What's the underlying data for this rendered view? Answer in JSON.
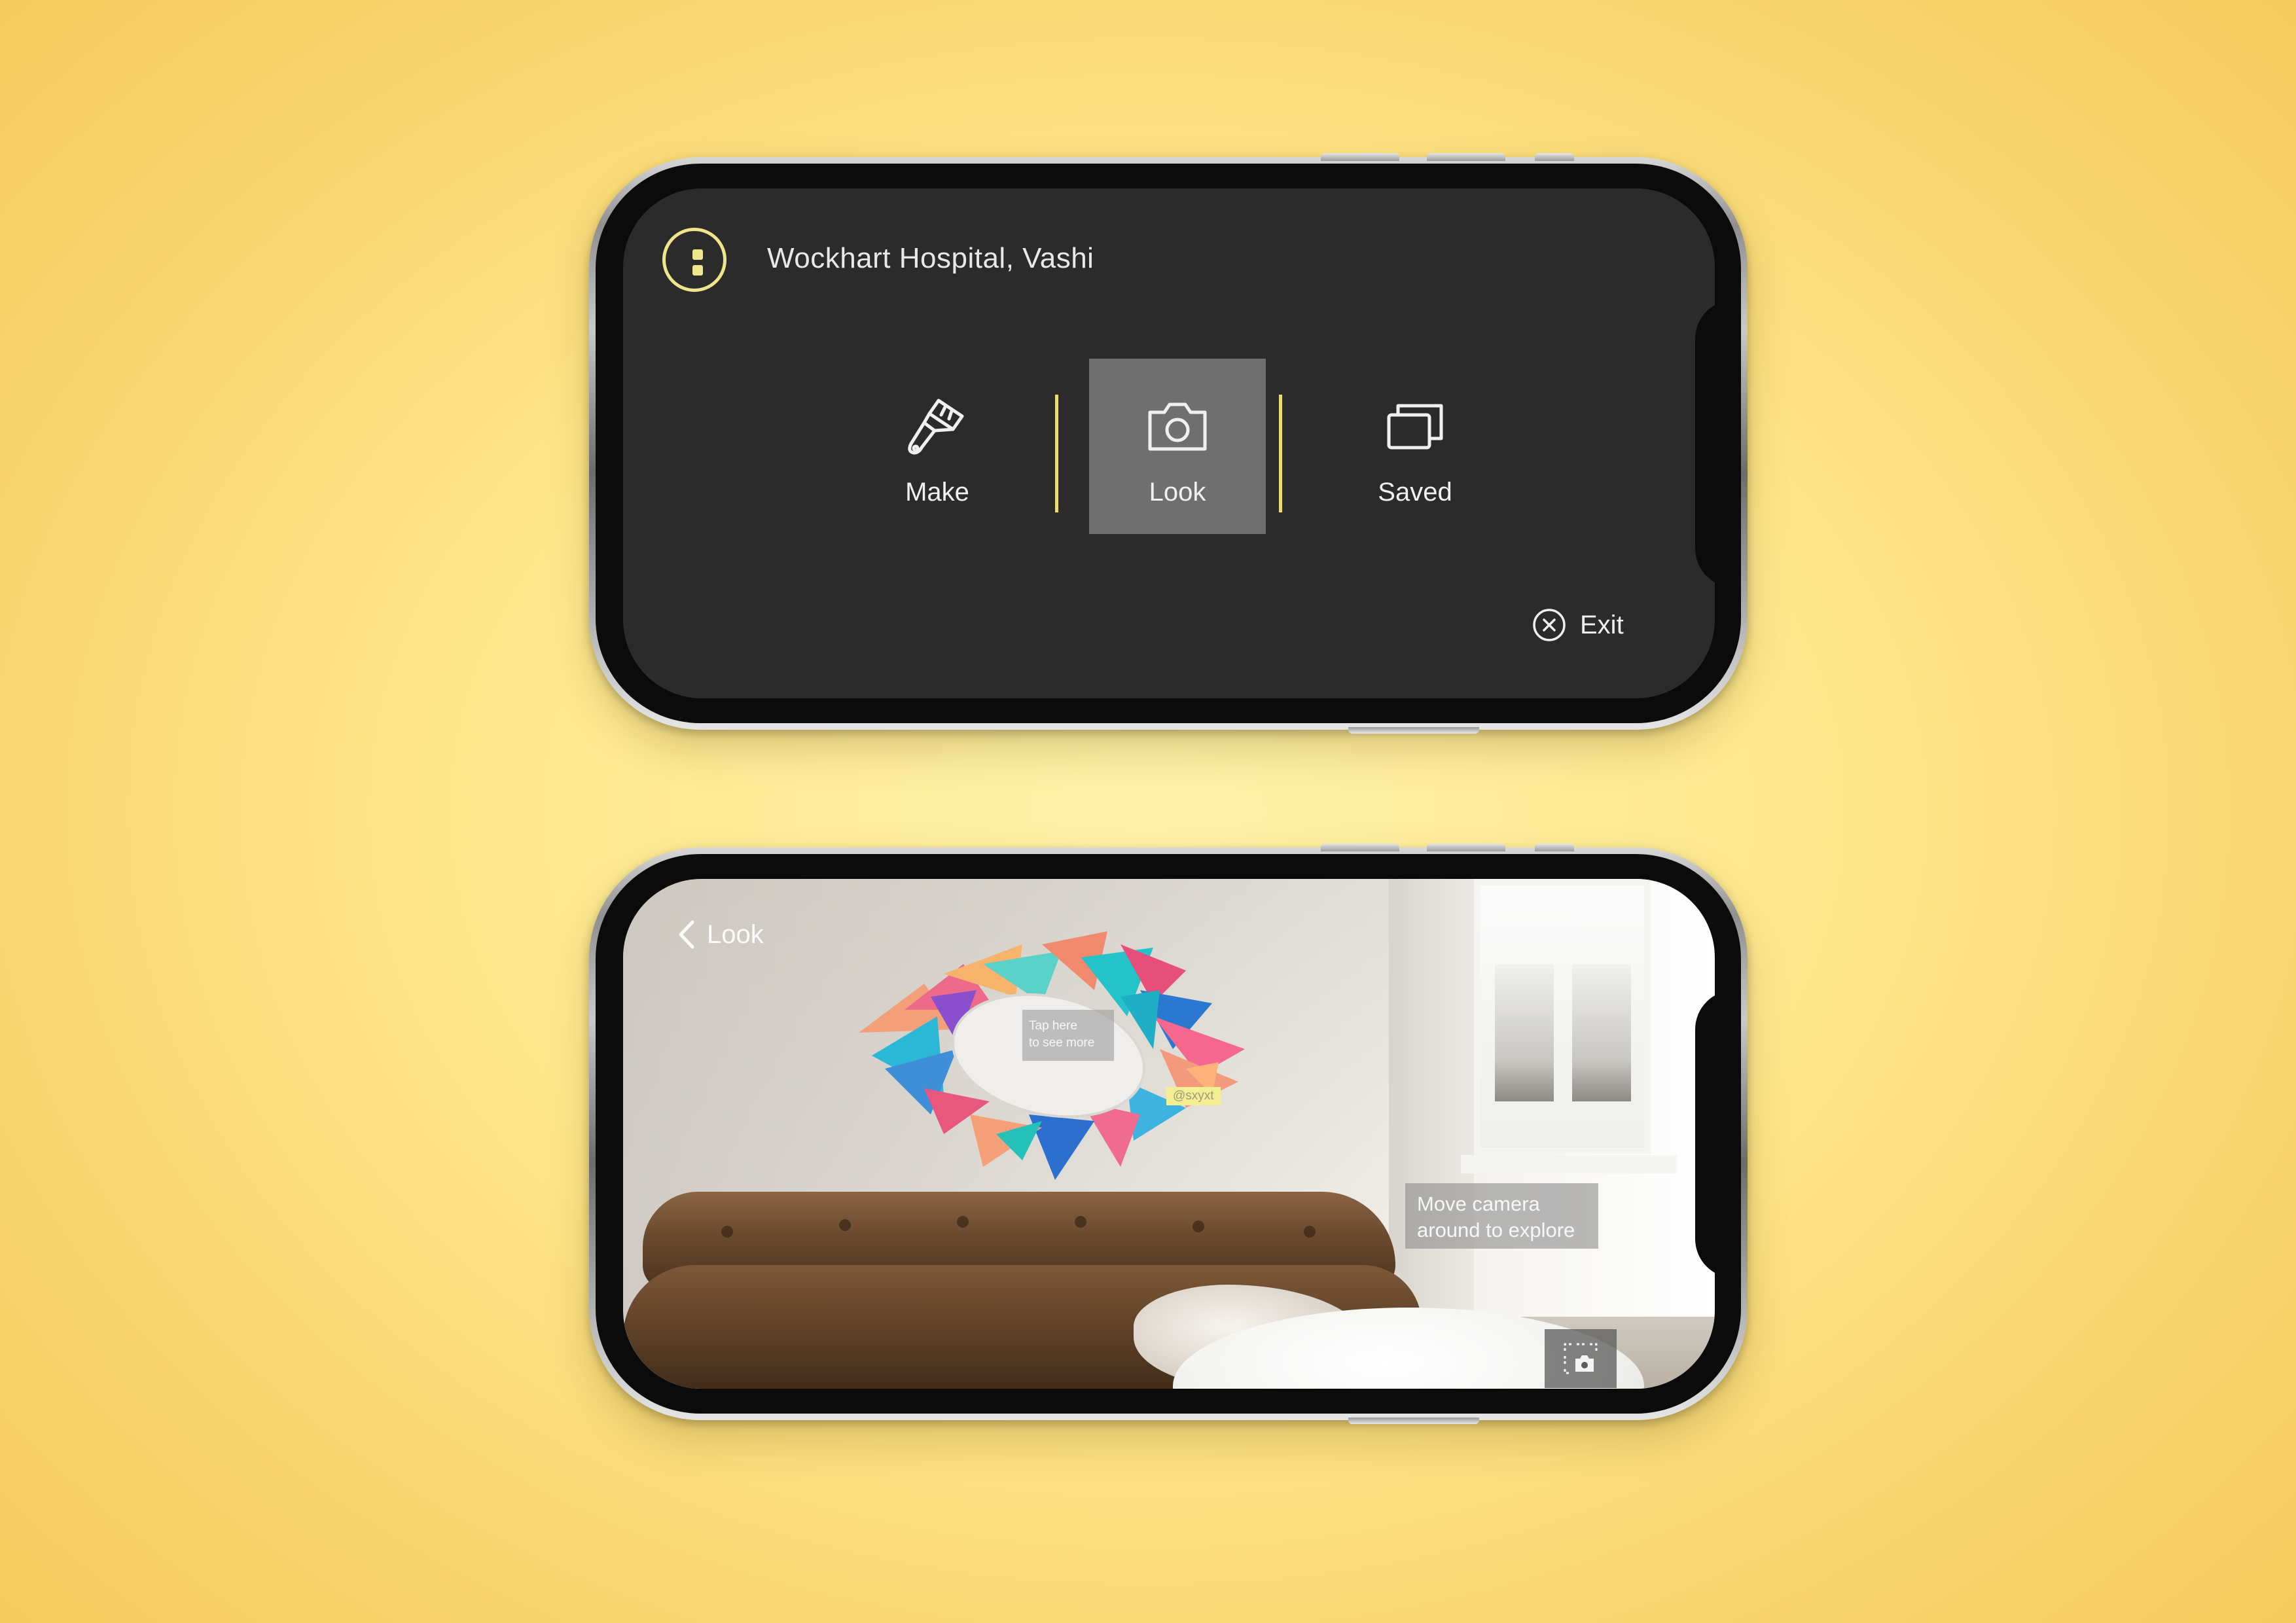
{
  "menu_screen": {
    "location_title": "Wockhart Hospital, Vashi",
    "menu_icon": "more-vertical-icon",
    "tabs": [
      {
        "label": "Make",
        "icon": "paintbrush-icon",
        "selected": false
      },
      {
        "label": "Look",
        "icon": "camera-icon",
        "selected": true
      },
      {
        "label": "Saved",
        "icon": "stacked-cards-icon",
        "selected": false
      }
    ],
    "exit": {
      "label": "Exit",
      "icon": "close-circle-icon"
    },
    "colors": {
      "background": "#2b2b2b",
      "accent": "#efe58c",
      "selected_tab": "#6f6f6f"
    }
  },
  "ar_screen": {
    "back_label": "Look",
    "back_icon": "chevron-left-icon",
    "artwork_tooltip": "Tap here\nto see more",
    "artist_handle": "@sxyxt",
    "hint": "Move camera\naround to explore",
    "capture_icon": "capture-frame-camera-icon"
  }
}
